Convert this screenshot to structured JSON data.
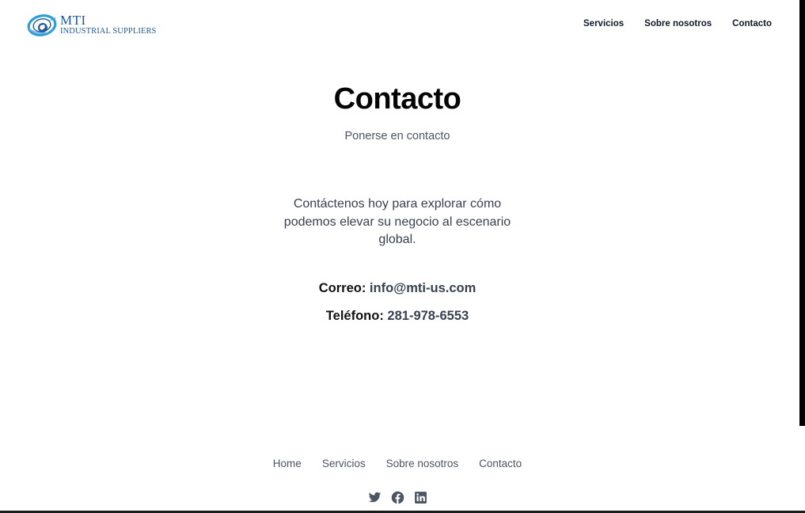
{
  "header": {
    "logo": {
      "line1": "MTI",
      "line2": "INDUSTRIAL SUPPLIERS"
    },
    "nav": [
      {
        "label": "Servicios"
      },
      {
        "label": "Sobre nosotros"
      },
      {
        "label": "Contacto"
      }
    ]
  },
  "main": {
    "title": "Contacto",
    "subtitle": "Ponerse en contacto",
    "intro": "Contáctenos hoy para explorar cómo podemos elevar su negocio al escenario global.",
    "email": {
      "label": "Correo:",
      "value": "info@mti-us.com"
    },
    "phone": {
      "label": "Teléfono:",
      "value": "281-978-6553"
    }
  },
  "footer": {
    "nav": [
      {
        "label": "Home"
      },
      {
        "label": "Servicios"
      },
      {
        "label": "Sobre nosotros"
      },
      {
        "label": "Contacto"
      }
    ],
    "social": [
      "twitter-icon",
      "facebook-icon",
      "linkedin-icon"
    ]
  },
  "colors": {
    "brand": "#1e5a96",
    "accent": "#2a9fd6",
    "text": "#111827",
    "muted": "#4b5563"
  }
}
